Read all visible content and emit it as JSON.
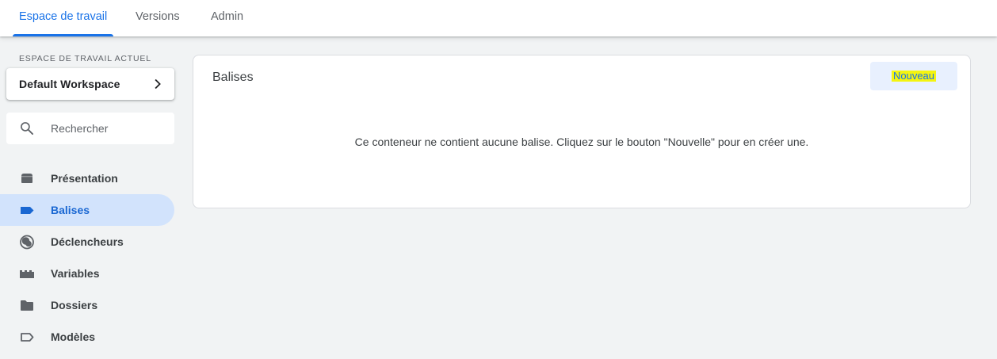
{
  "tabs": [
    {
      "label": "Espace de travail",
      "active": true
    },
    {
      "label": "Versions",
      "active": false
    },
    {
      "label": "Admin",
      "active": false
    }
  ],
  "workspace": {
    "section_label": "ESPACE DE TRAVAIL ACTUEL",
    "name": "Default Workspace",
    "chevron_icon": "chevron-right-icon"
  },
  "search": {
    "placeholder": "Rechercher",
    "value": "",
    "icon": "search-icon"
  },
  "nav": [
    {
      "label": "Présentation",
      "icon": "overview-icon",
      "active": false
    },
    {
      "label": "Balises",
      "icon": "tag-icon",
      "active": true
    },
    {
      "label": "Déclencheurs",
      "icon": "trigger-icon",
      "active": false
    },
    {
      "label": "Variables",
      "icon": "variables-icon",
      "active": false
    },
    {
      "label": "Dossiers",
      "icon": "folder-icon",
      "active": false
    },
    {
      "label": "Modèles",
      "icon": "template-icon",
      "active": false
    }
  ],
  "panel": {
    "title": "Balises",
    "new_button": "Nouveau",
    "empty_message": "Ce conteneur ne contient aucune balise. Cliquez sur le bouton \"Nouvelle\" pour en créer une."
  },
  "colors": {
    "accent": "#1a73e8",
    "active_nav_bg": "#d2e3fc",
    "highlight": "#f4f410",
    "page_bg": "#f1f3f4"
  }
}
